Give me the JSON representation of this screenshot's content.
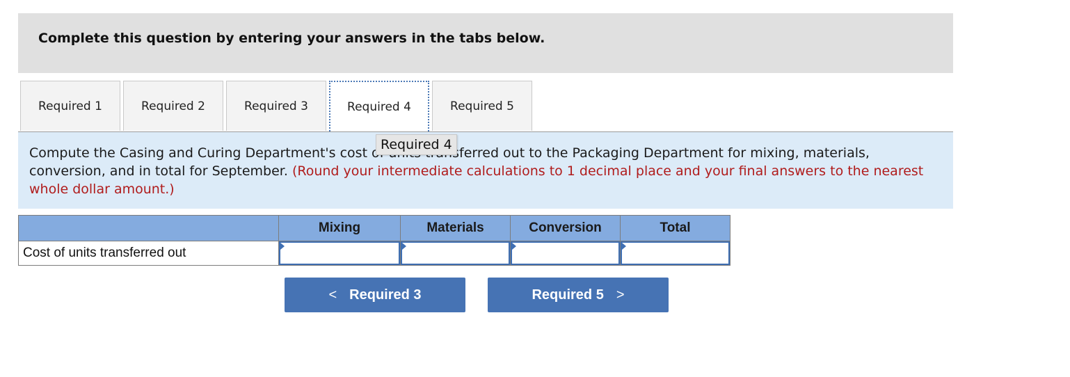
{
  "header": {
    "title": "Complete this question by entering your answers in the tabs below."
  },
  "tabs": [
    {
      "label": "Required 1",
      "active": false
    },
    {
      "label": "Required 2",
      "active": false
    },
    {
      "label": "Required 3",
      "active": false
    },
    {
      "label": "Required 4",
      "active": true
    },
    {
      "label": "Required 5",
      "active": false
    }
  ],
  "tooltip": "Required 4",
  "instructions": {
    "main": "Compute the Casing and Curing Department's cost of units transferred out to the Packaging Department for mixing, materials, conversion, and in total for September.",
    "note": "(Round your intermediate calculations to 1 decimal place and your final answers to the nearest whole dollar amount.)"
  },
  "table": {
    "columns": [
      "",
      "Mixing",
      "Materials",
      "Conversion",
      "Total"
    ],
    "rows": [
      {
        "label": "Cost of units transferred out",
        "values": [
          "",
          "",
          "",
          ""
        ]
      }
    ]
  },
  "nav": {
    "prev": {
      "label": "Required 3",
      "icon": "chevron-left-icon",
      "glyph": "<"
    },
    "next": {
      "label": "Required 5",
      "icon": "chevron-right-icon",
      "glyph": ">"
    }
  }
}
